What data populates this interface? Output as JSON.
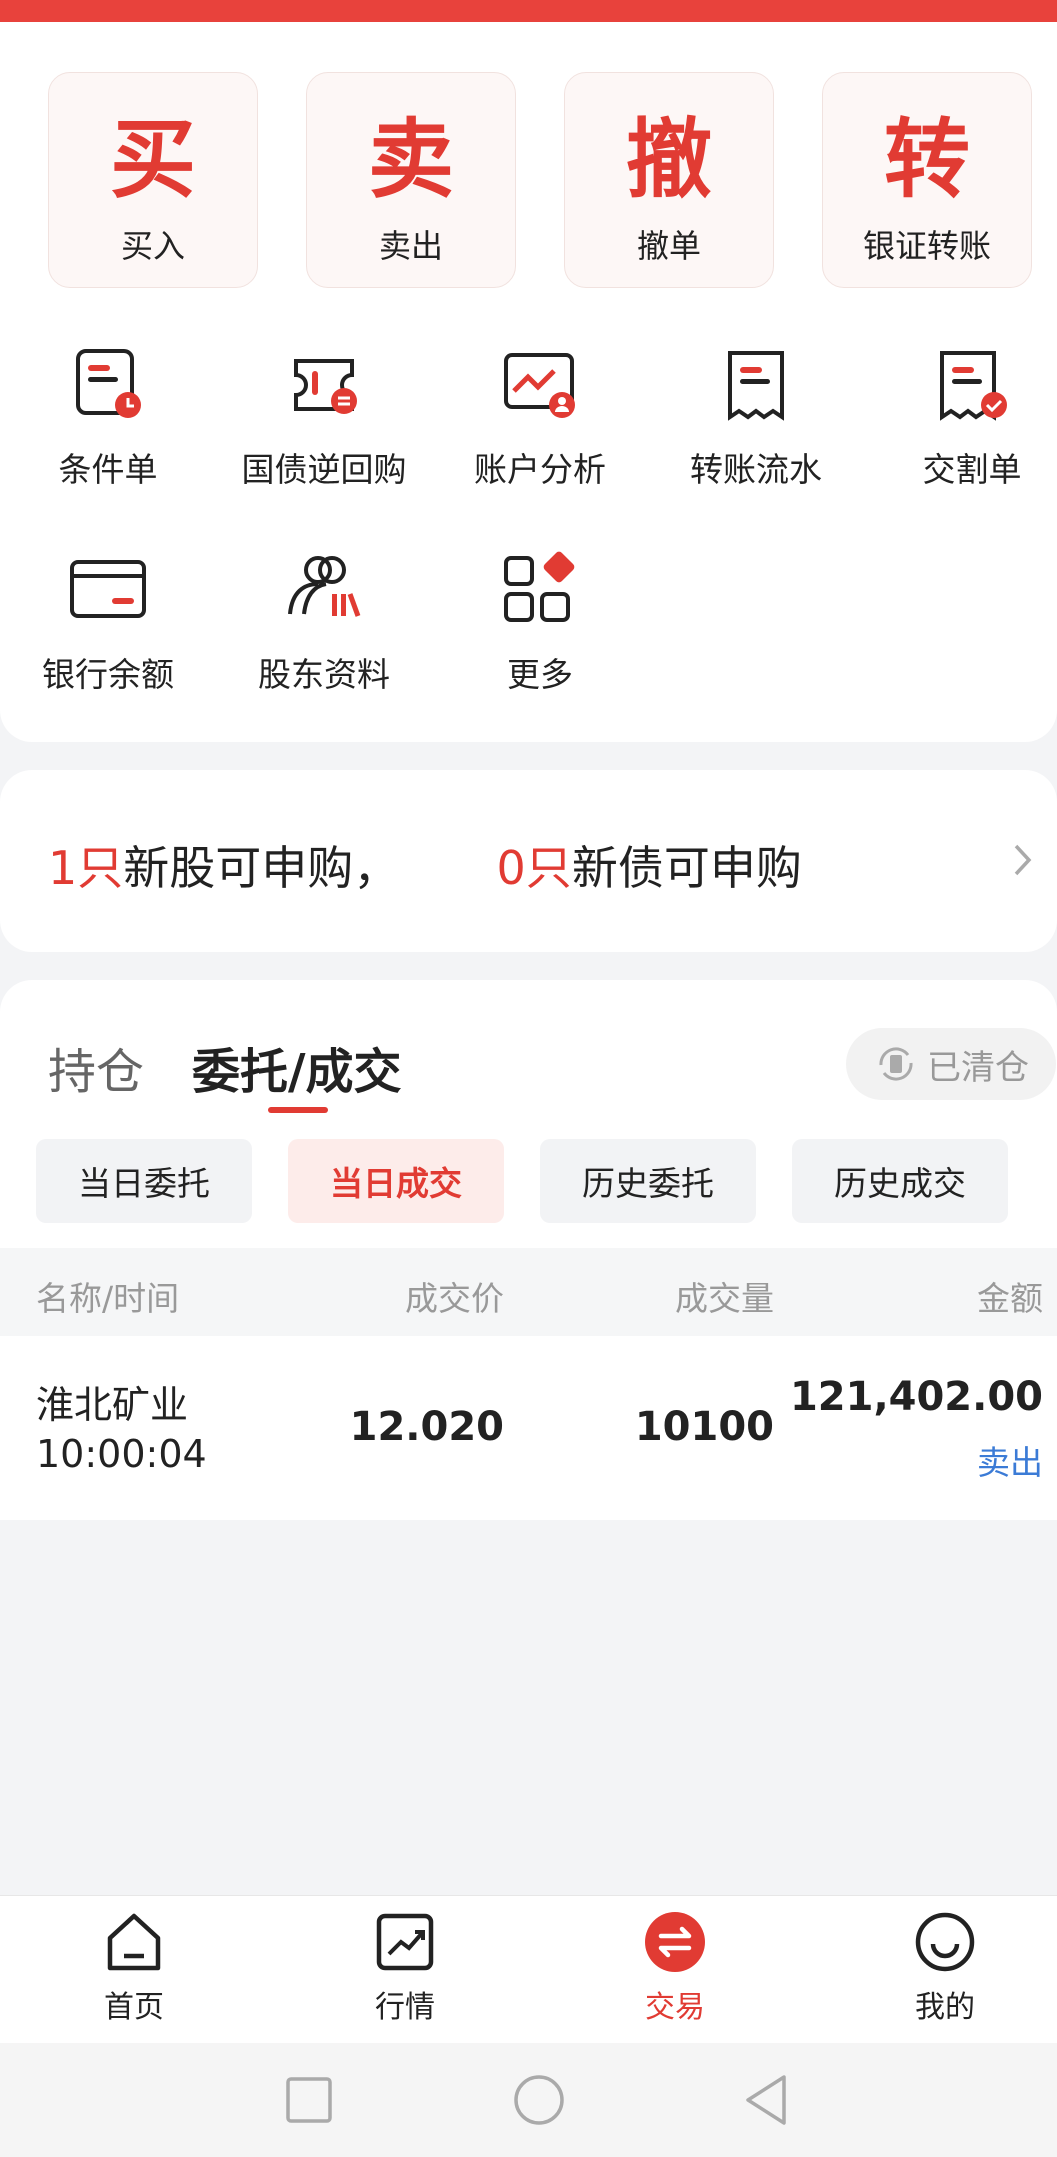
{
  "quick_actions": [
    {
      "glyph": "买",
      "label": "买入"
    },
    {
      "glyph": "卖",
      "label": "卖出"
    },
    {
      "glyph": "撤",
      "label": "撤单"
    },
    {
      "glyph": "转",
      "label": "银证转账"
    }
  ],
  "functions": [
    {
      "icon": "conditional-order-icon",
      "label": "条件单"
    },
    {
      "icon": "bond-repo-icon",
      "label": "国债逆回购"
    },
    {
      "icon": "account-analysis-icon",
      "label": "账户分析"
    },
    {
      "icon": "transfer-record-icon",
      "label": "转账流水"
    },
    {
      "icon": "delivery-order-icon",
      "label": "交割单"
    },
    {
      "icon": "bank-card-icon",
      "label": "银行余额"
    },
    {
      "icon": "shareholder-icon",
      "label": "股东资料"
    },
    {
      "icon": "more-grid-icon",
      "label": "更多"
    }
  ],
  "ipo": {
    "stock_count": "1只",
    "stock_text": "新股可申购，",
    "bond_count": "0只",
    "bond_text": "新债可申购"
  },
  "tabs": {
    "holdings": "持仓",
    "orders": "委托/成交",
    "cleared": "已清仓"
  },
  "subtabs": [
    "当日委托",
    "当日成交",
    "历史委托",
    "历史成交"
  ],
  "table": {
    "headers": {
      "name": "名称/时间",
      "price": "成交价",
      "volume": "成交量",
      "amount": "金额"
    },
    "rows": [
      {
        "name": "淮北矿业",
        "time": "10:00:04",
        "price": "12.020",
        "volume": "10100",
        "amount": "121,402.00",
        "side": "卖出"
      }
    ]
  },
  "bottom_nav": [
    {
      "icon": "home-icon",
      "label": "首页"
    },
    {
      "icon": "market-chart-icon",
      "label": "行情"
    },
    {
      "icon": "trade-exchange-icon",
      "label": "交易"
    },
    {
      "icon": "smile-profile-icon",
      "label": "我的"
    }
  ],
  "colors": {
    "accent": "#e13b33",
    "link": "#3b7bd6",
    "muted": "#999999"
  }
}
